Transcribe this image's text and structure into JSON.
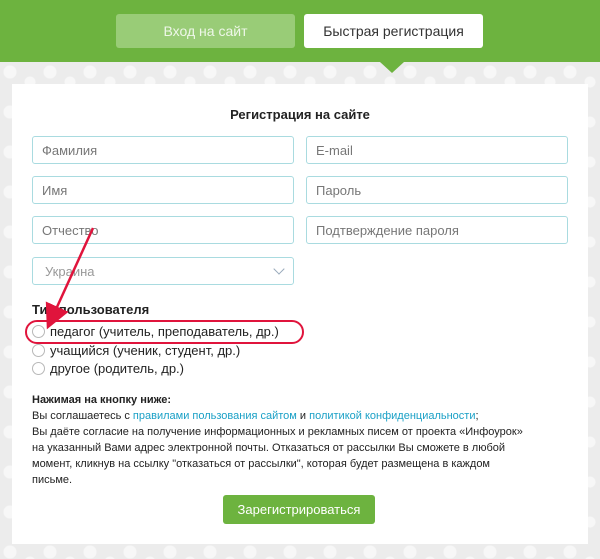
{
  "tabs": {
    "login_label": "Вход на сайт",
    "register_label": "Быстрая регистрация"
  },
  "form": {
    "title": "Регистрация на сайте",
    "fields": {
      "lastname_placeholder": "Фамилия",
      "email_placeholder": "E-mail",
      "firstname_placeholder": "Имя",
      "password_placeholder": "Пароль",
      "patronymic_placeholder": "Отчество",
      "password_confirm_placeholder": "Подтверждение пароля"
    },
    "country_selected": "Украина",
    "user_type_label": "Тип пользователя",
    "user_types": [
      "педагог (учитель, преподаватель, др.)",
      "учащийся (ученик, студент, др.)",
      "другое (родитель, др.)"
    ],
    "note": {
      "heading": "Нажимая на кнопку ниже:",
      "line1_prefix": "Вы соглашаетесь с ",
      "terms_link": "правилами пользования сайтом",
      "line1_and": " и ",
      "privacy_link": "политикой конфиденциальности",
      "line1_suffix": ";",
      "line2": "Вы даёте согласие на получение информационных и рекламных писем от проекта «Инфоурок» на указанный Вами адрес электронной почты. Отказаться от рассылки Вы сможете в любой момент, кликнув на ссылку \"отказаться от рассылки\", которая будет размещена в каждом письме."
    },
    "submit_label": "Зарегистрироваться"
  },
  "colors": {
    "brand_green": "#6db33f",
    "field_border": "#a9dbe0",
    "link": "#1aa0c6",
    "annotation_red": "#e0143c"
  }
}
